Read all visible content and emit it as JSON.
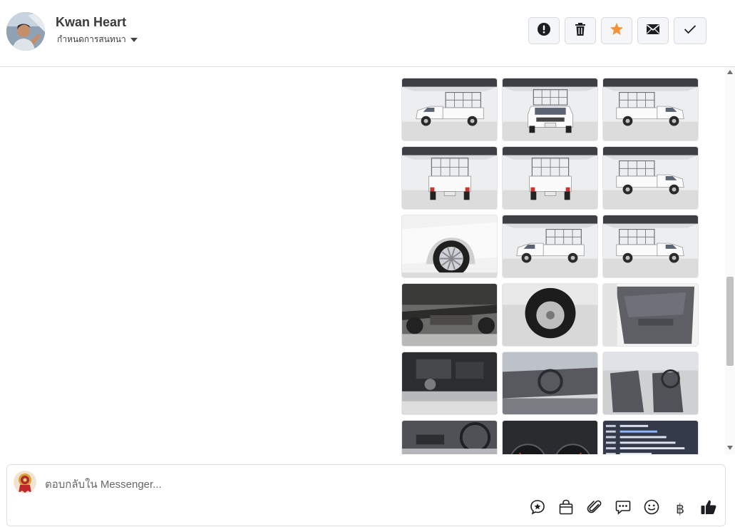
{
  "header": {
    "name": "Kwan Heart",
    "assign_label": "กำหนดการสนทนา",
    "toolbar": [
      {
        "id": "spam",
        "icon": "alert-circle-icon"
      },
      {
        "id": "delete",
        "icon": "trash-icon"
      },
      {
        "id": "star",
        "icon": "star-icon",
        "color": "#f7923a"
      },
      {
        "id": "unread",
        "icon": "envelope-icon"
      },
      {
        "id": "done",
        "icon": "check-icon"
      }
    ]
  },
  "conversation": {
    "photos": [
      {
        "subject": "truck front-left 3/4"
      },
      {
        "subject": "truck front"
      },
      {
        "subject": "truck front-right 3/4"
      },
      {
        "subject": "truck rear-left 3/4"
      },
      {
        "subject": "truck rear"
      },
      {
        "subject": "truck side"
      },
      {
        "subject": "wheel and fender"
      },
      {
        "subject": "truck rear-right 3/4"
      },
      {
        "subject": "truck side right"
      },
      {
        "subject": "undercarriage"
      },
      {
        "subject": "spare tire"
      },
      {
        "subject": "door interior"
      },
      {
        "subject": "engine bay"
      },
      {
        "subject": "dashboard"
      },
      {
        "subject": "front seats"
      },
      {
        "subject": "center console"
      },
      {
        "subject": "gauge cluster"
      },
      {
        "subject": "spec sheet"
      }
    ]
  },
  "composer": {
    "placeholder": "ตอบกลับใน Messenger...",
    "actions": [
      {
        "id": "sticker",
        "icon": "sticker-icon"
      },
      {
        "id": "shop",
        "icon": "shopping-bag-icon"
      },
      {
        "id": "attach",
        "icon": "paperclip-icon"
      },
      {
        "id": "saved-replies",
        "icon": "chat-bubble-icon"
      },
      {
        "id": "emoji",
        "icon": "smiley-icon"
      },
      {
        "id": "payment",
        "icon": "baht-icon",
        "glyph": "฿"
      },
      {
        "id": "like",
        "icon": "thumbs-up-icon"
      }
    ]
  }
}
